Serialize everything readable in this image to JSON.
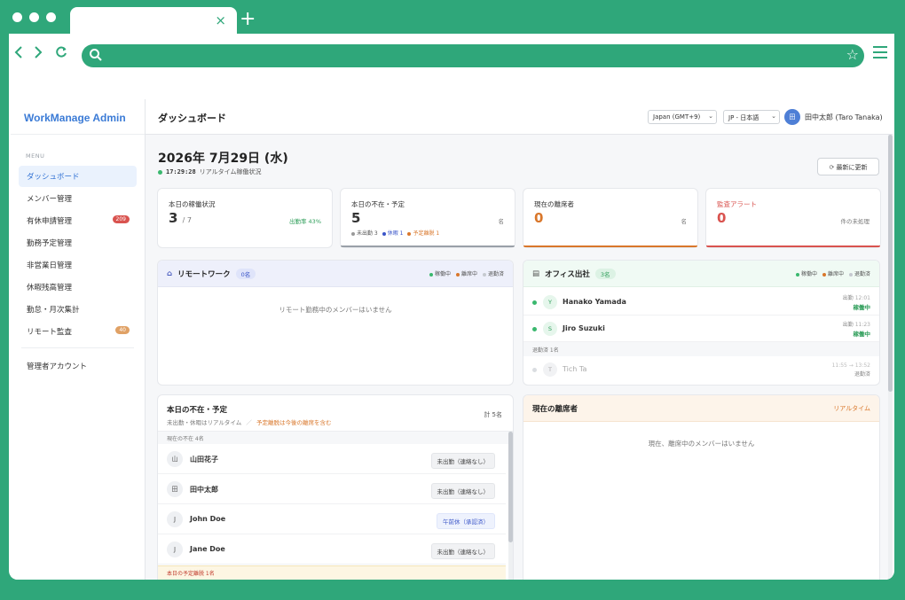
{
  "browser": {
    "tab_close": "×",
    "new_tab": "+"
  },
  "app": {
    "brand": "WorkManage Admin",
    "menu_label": "MENU",
    "nav": [
      {
        "label": "ダッシュボード",
        "active": true
      },
      {
        "label": "メンバー管理"
      },
      {
        "label": "有休申請管理",
        "badge": "209"
      },
      {
        "label": "勤務予定管理"
      },
      {
        "label": "非営業日管理"
      },
      {
        "label": "休暇残高管理"
      },
      {
        "label": "勤怠・月次集計"
      },
      {
        "label": "リモート監査",
        "badge": "40"
      }
    ],
    "admin_account": "管理者アカウント"
  },
  "header": {
    "title": "ダッシュボード",
    "timezone": "Japan (GMT+9)",
    "language": "JP - 日本語",
    "user_initial": "田",
    "user_name": "田中太郎 (Taro Tanaka)"
  },
  "summary": {
    "date": "2026年 7月29日 (水)",
    "time": "17:29:28",
    "live_label": "リアルタイム稼働状況",
    "refresh_label": "最新に更新"
  },
  "stats": {
    "working": {
      "label": "本日の稼働状況",
      "value": "3",
      "sub": "/ 7",
      "right": "出勤率 43%"
    },
    "absent": {
      "label": "本日の不在・予定",
      "value": "5",
      "right": "名",
      "legend": [
        "未出勤 3",
        "休暇 1",
        "予定離脱 1"
      ]
    },
    "away": {
      "label": "現在の離席者",
      "value": "0",
      "right": "名"
    },
    "alerts": {
      "label": "監査アラート",
      "value": "0",
      "right": "件の未処理"
    }
  },
  "remote": {
    "title": "リモートワーク",
    "count": "0名",
    "legend": [
      "稼働中",
      "離席中",
      "退勤済"
    ],
    "empty": "リモート勤務中のメンバーはいません"
  },
  "office": {
    "title": "オフィス出社",
    "count": "3名",
    "legend": [
      "稼働中",
      "離席中",
      "退勤済"
    ],
    "members": [
      {
        "initial": "Y",
        "name": "Hanako Yamada",
        "label": "出勤",
        "time": "12:01",
        "state": "稼働中"
      },
      {
        "initial": "S",
        "name": "Jiro Suzuki",
        "label": "出勤",
        "time": "11:23",
        "state": "稼働中"
      }
    ],
    "left_label": "退勤済 1名",
    "left_member": {
      "initial": "T",
      "name": "Tich Ta",
      "time": "11:55 → 13:52",
      "state": "退勤済"
    }
  },
  "absent_panel": {
    "title": "本日の不在・予定",
    "subtitle": "未出勤・休暇はリアルタイム",
    "sep": "／",
    "note": "予定離脱は今後の離席を含む",
    "total": "計 5名",
    "section": "現在の不在 4名",
    "rows": [
      {
        "initial": "山",
        "name": "山田花子",
        "tag": "未出勤（連絡なし）"
      },
      {
        "initial": "田",
        "name": "田中太郎",
        "tag": "未出勤（連絡なし）"
      },
      {
        "initial": "J",
        "name": "John Doe",
        "tag": "午前休（承認済）"
      },
      {
        "initial": "J",
        "name": "Jane Doe",
        "tag": "未出勤（連絡なし）"
      }
    ],
    "footer": "本日の予定離脱 1名"
  },
  "away_panel": {
    "title": "現在の離席者",
    "live": "リアルタイム",
    "empty": "現在、離席中のメンバーはいません"
  },
  "colors": {
    "brand_green": "#2fa77a",
    "accent_blue": "#3b7bd6",
    "orange": "#d9772b",
    "red": "#d9534f"
  }
}
